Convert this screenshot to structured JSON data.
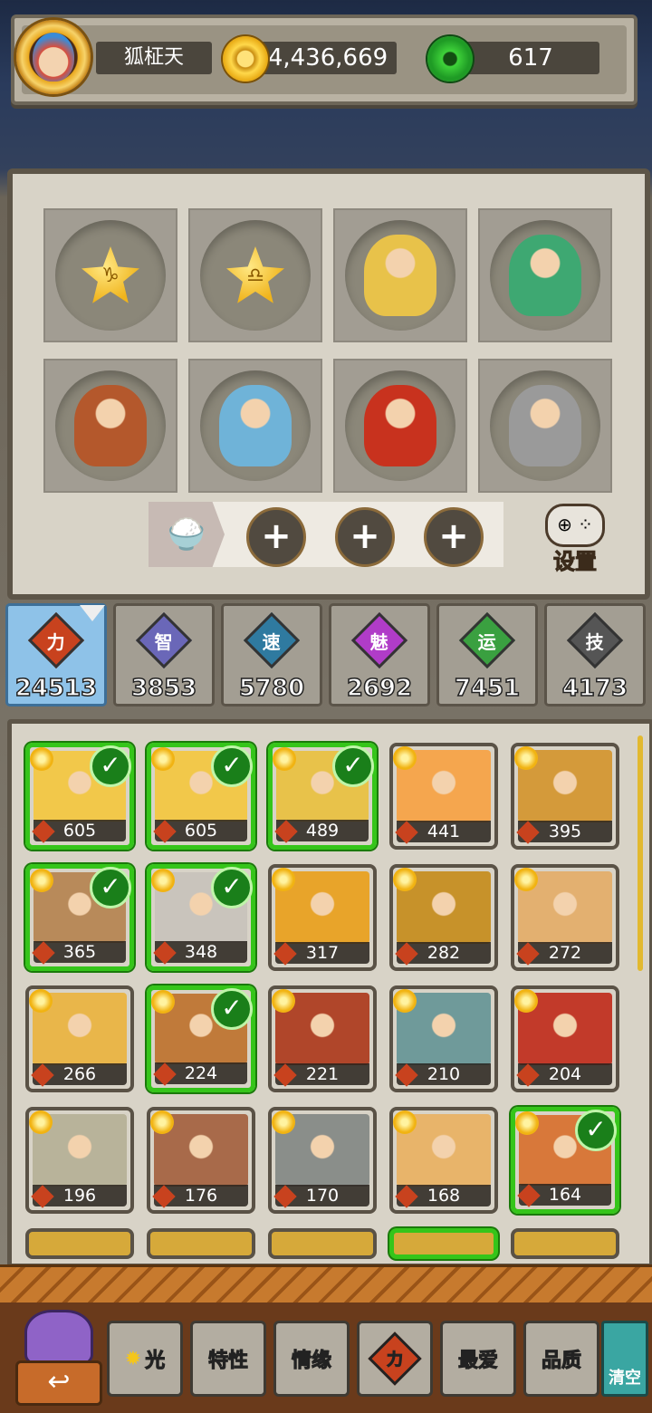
{
  "player": {
    "name": "狐柾天",
    "coins": "4,436,669",
    "gems": "617"
  },
  "team_slots": [
    {
      "type": "star",
      "symbol": "♑"
    },
    {
      "type": "star",
      "symbol": "♎"
    },
    {
      "type": "hero",
      "color": "#e8c24a"
    },
    {
      "type": "hero",
      "color": "#3ea872"
    },
    {
      "type": "hero",
      "color": "#b4582c"
    },
    {
      "type": "hero",
      "color": "#6fb3d8"
    },
    {
      "type": "hero",
      "color": "#c8321e"
    },
    {
      "type": "hero",
      "color": "#9a9a9a"
    }
  ],
  "settings_label": "设置",
  "stats": [
    {
      "icon": "力",
      "value": "24513",
      "color": "#c8421e"
    },
    {
      "icon": "智",
      "value": "3853",
      "color": "#6a67b8"
    },
    {
      "icon": "速",
      "value": "5780",
      "color": "#2f7aa0"
    },
    {
      "icon": "魅",
      "value": "2692",
      "color": "#b03cc8"
    },
    {
      "icon": "运",
      "value": "7451",
      "color": "#3aa040"
    },
    {
      "icon": "技",
      "value": "4173",
      "color": "#555555"
    }
  ],
  "heroes": [
    {
      "power": "605",
      "selected": true,
      "color": "#f2c84a"
    },
    {
      "power": "605",
      "selected": true,
      "color": "#f2c84a"
    },
    {
      "power": "489",
      "selected": true,
      "color": "#e8c24a"
    },
    {
      "power": "441",
      "selected": false,
      "color": "#f5a64e"
    },
    {
      "power": "395",
      "selected": false,
      "color": "#d49a3a"
    },
    {
      "power": "365",
      "selected": true,
      "color": "#b88a5a"
    },
    {
      "power": "348",
      "selected": true,
      "color": "#c9c4bc"
    },
    {
      "power": "317",
      "selected": false,
      "color": "#e8a42a"
    },
    {
      "power": "282",
      "selected": false,
      "color": "#c7922a"
    },
    {
      "power": "272",
      "selected": false,
      "color": "#e3b070"
    },
    {
      "power": "266",
      "selected": false,
      "color": "#e9b64a"
    },
    {
      "power": "224",
      "selected": true,
      "color": "#c07a3a"
    },
    {
      "power": "221",
      "selected": false,
      "color": "#b0462a"
    },
    {
      "power": "210",
      "selected": false,
      "color": "#6f9a9a"
    },
    {
      "power": "204",
      "selected": false,
      "color": "#c23a2a"
    },
    {
      "power": "196",
      "selected": false,
      "color": "#b8b39a"
    },
    {
      "power": "176",
      "selected": false,
      "color": "#a86a4a"
    },
    {
      "power": "170",
      "selected": false,
      "color": "#8a8e8a"
    },
    {
      "power": "168",
      "selected": false,
      "color": "#e8b46a"
    },
    {
      "power": "164",
      "selected": true,
      "color": "#d8783a"
    }
  ],
  "bottom_buttons": {
    "light": "光",
    "traits": "特性",
    "bond": "情缘",
    "power": "力",
    "favorite": "最爱",
    "quality": "品质",
    "clear": "清空"
  }
}
